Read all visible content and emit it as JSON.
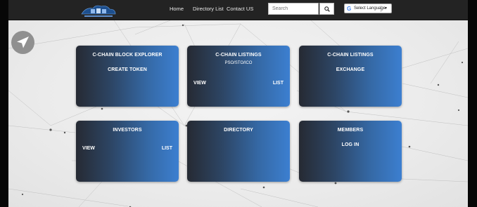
{
  "navbar": {
    "links": [
      "Home",
      "Directory List",
      "Contact US"
    ],
    "search_placeholder": "Search",
    "language_label": "Select Language"
  },
  "cards": {
    "block_explorer": {
      "title": "C-CHAIN BLOCK EXPLORER",
      "action": "CREATE TOKEN"
    },
    "listings_pso": {
      "title": "C-CHAIN LISTINGS",
      "subtitle": "PSO/STO/ICO",
      "left": "VIEW",
      "right": "LIST"
    },
    "listings_exchange": {
      "title": "C-CHAIN LISTINGS",
      "action": "EXCHANGE"
    },
    "investors": {
      "title": "INVESTORS",
      "left": "VIEW",
      "right": "LIST"
    },
    "directory": {
      "title": "DIRECTORY"
    },
    "members": {
      "title": "MEMBERS",
      "action": "LOG IN"
    }
  },
  "colors": {
    "navbar": "#232323",
    "card_dark": "#262a33",
    "card_blue": "#3c7fd0",
    "fab": "#909090"
  },
  "icons": [
    "logo-icon",
    "search-icon",
    "google-icon",
    "chevron-down-icon",
    "navigation-arrow-icon"
  ]
}
